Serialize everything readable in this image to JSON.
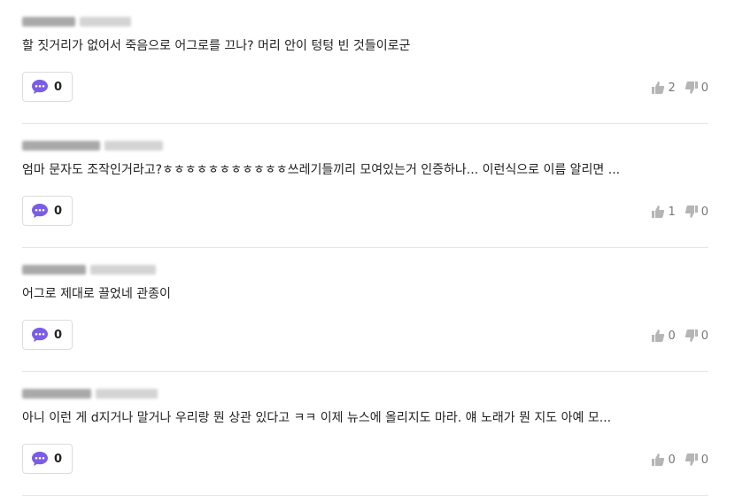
{
  "comments": [
    {
      "text": "할 짓거리가 없어서 죽음으로 어그로를 끄나? 머리 안이 텅텅 빈 것들이로군",
      "reply_count": "0",
      "likes": "2",
      "dislikes": "0"
    },
    {
      "text": "엄마 문자도 조작인거라고?ㅎㅎㅎㅎㅎㅎㅎㅎㅎㅎㅎ쓰레기들끼리 모여있는거 인증하나... 이런식으로 이름 알리면 ...",
      "reply_count": "0",
      "likes": "1",
      "dislikes": "0"
    },
    {
      "text": "어그로 제대로 끌었네 관종이",
      "reply_count": "0",
      "likes": "0",
      "dislikes": "0"
    },
    {
      "text": "아니 이런 게 d지거나 말거나 우리랑 뭔 상관 있다고 ㅋㅋ 이제 뉴스에 올리지도 마라. 얘 노래가 뭔 지도 아예 모...",
      "reply_count": "0",
      "likes": "0",
      "dislikes": "0"
    }
  ],
  "icons": {
    "reply": "speech-bubble-icon",
    "like": "thumbs-up-icon",
    "dislike": "thumbs-down-icon"
  },
  "colors": {
    "accent": "#7b5ce6",
    "divider": "#e6e6e6",
    "icon_gray": "#b5b5b5"
  }
}
